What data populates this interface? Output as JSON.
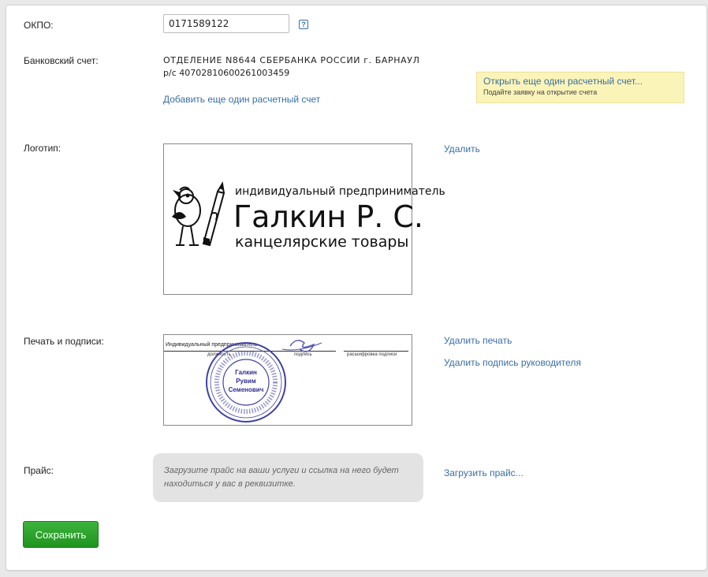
{
  "okpo": {
    "label": "ОКПО:",
    "value": "0171589122",
    "help_glyph": "?"
  },
  "bank": {
    "label": "Банковский счет:",
    "name": "ОТДЕЛЕНИЕ N8644 СБЕРБАНКА РОССИИ г. БАРНАУЛ",
    "account": "р/с 40702810600261003459",
    "add_link": "Добавить еще один расчетный счет",
    "tip": {
      "title": "Открыть еще один расчетный счет...",
      "subtitle": "Подайте заявку на открытие счета"
    }
  },
  "logo": {
    "label": "Логотип:",
    "delete_link": "Удалить",
    "image": {
      "line1": "индивидуальный предприниматель",
      "line2": "Галкин Р. С.",
      "line3": "канцелярские товары"
    }
  },
  "seal": {
    "label": "Печать и подписи:",
    "delete_seal_link": "Удалить печать",
    "delete_signature_link": "Удалить подпись руководителя",
    "image": {
      "header": "Индивидуальный предприниматель",
      "caption_position": "должность",
      "caption_signature": "подпись",
      "caption_decoding": "расшифровка подписи",
      "stamp_line1": "Галкин",
      "stamp_line2": "Рувим",
      "stamp_line3": "Семенович"
    }
  },
  "price": {
    "label": "Прайс:",
    "hint": "Загрузите прайс на ваши услуги и ссылка на него будет находиться у вас в реквизитке.",
    "upload_link": "Загрузить прайс..."
  },
  "save_label": "Сохранить",
  "colors": {
    "link": "#3a6ea5",
    "save_button": "#2aa52a",
    "tip_bg": "#fbf4b8",
    "stamp": "#3a3aa0"
  }
}
